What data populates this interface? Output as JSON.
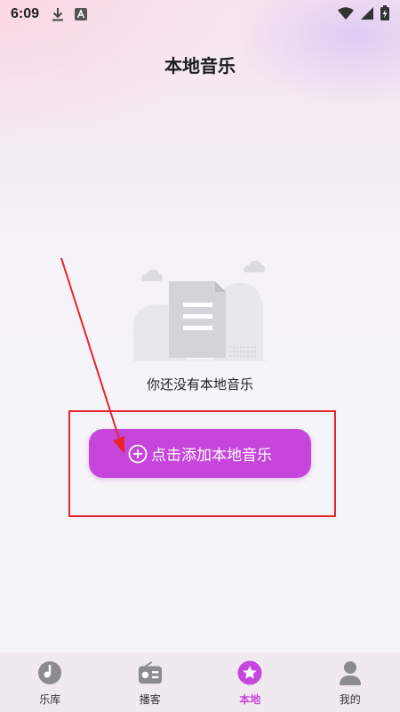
{
  "status_bar": {
    "time": "6:09",
    "icons": [
      "download-icon",
      "a-box-icon",
      "wifi-icon",
      "cellular-icon",
      "battery-charging-icon"
    ]
  },
  "header": {
    "title": "本地音乐"
  },
  "empty_state": {
    "illustration": "empty-document-icon",
    "message": "你还没有本地音乐"
  },
  "add_button": {
    "icon": "plus-circle-icon",
    "label": "点击添加本地音乐"
  },
  "annotation": {
    "color": "#e8232a"
  },
  "accent_color": "#c646dc",
  "bottom_nav": {
    "items": [
      {
        "label": "乐库",
        "icon": "music-disc-icon",
        "active": false
      },
      {
        "label": "播客",
        "icon": "radio-icon",
        "active": false
      },
      {
        "label": "本地",
        "icon": "star-icon",
        "active": true
      },
      {
        "label": "我的",
        "icon": "user-icon",
        "active": false
      }
    ]
  }
}
